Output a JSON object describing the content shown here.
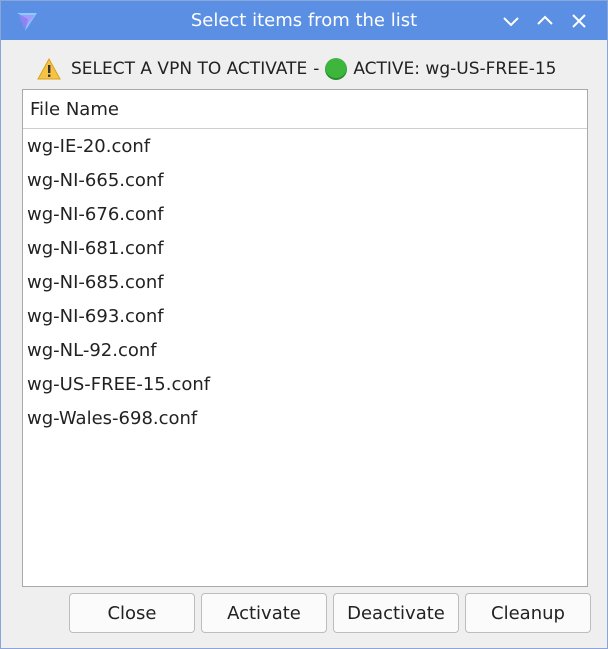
{
  "window": {
    "title": "Select items from the list",
    "title_bar_color": "#5a8fe3"
  },
  "banner": {
    "warning_icon": "warning-icon",
    "instruction": "SELECT A VPN TO ACTIVATE",
    "separator": "-",
    "status_icon": "green-circle-icon",
    "active_text": "ACTIVE: wg-US-FREE-15"
  },
  "list": {
    "column_header": "File Name",
    "items": [
      "wg-IE-20.conf",
      "wg-NI-665.conf",
      "wg-NI-676.conf",
      "wg-NI-681.conf",
      "wg-NI-685.conf",
      "wg-NI-693.conf",
      "wg-NL-92.conf",
      "wg-US-FREE-15.conf",
      "wg-Wales-698.conf"
    ]
  },
  "buttons": {
    "close": "Close",
    "activate": "Activate",
    "deactivate": "Deactivate",
    "cleanup": "Cleanup"
  }
}
